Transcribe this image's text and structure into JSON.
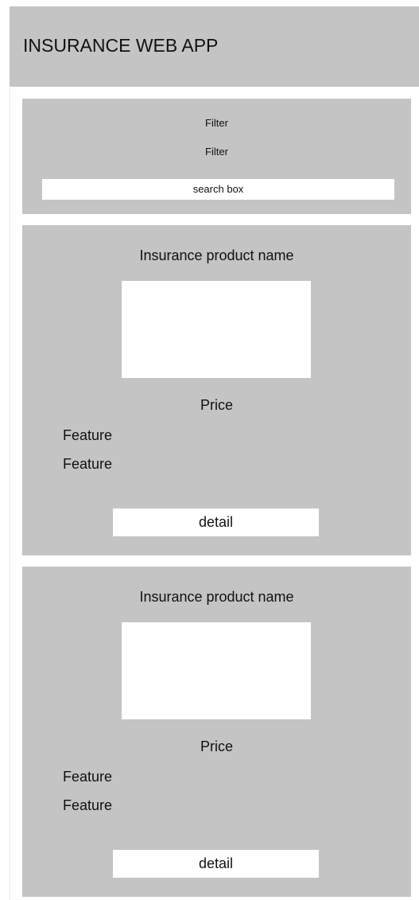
{
  "header": {
    "title": "INSURANCE WEB APP"
  },
  "filters": {
    "items": [
      "Filter",
      "Filter"
    ],
    "search_value": "search box"
  },
  "products": [
    {
      "name": "Insurance product name",
      "price": "Price",
      "features": [
        "Feature",
        "Feature"
      ],
      "detail_label": "detail"
    },
    {
      "name": "Insurance product name",
      "price": "Price",
      "features": [
        "Feature",
        "Feature"
      ],
      "detail_label": "detail"
    }
  ],
  "colors": {
    "panel": "#c4c4c4",
    "background": "#ffffff",
    "text": "#111111"
  }
}
